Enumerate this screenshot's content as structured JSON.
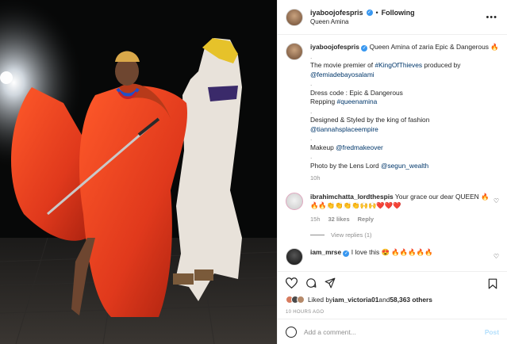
{
  "header": {
    "username": "iyaboojofespris",
    "separator": "•",
    "follow_status": "Following",
    "location": "Queen Amina",
    "more_icon": "more-horizontal-icon"
  },
  "caption": {
    "username": "iyaboojofespris",
    "title": "Queen Amina of zaria Epic & Dangerous 🔥",
    "line_premier_prefix": "The movie premier of ",
    "hashtag_movie": "#KingOfThieves",
    "line_premier_suffix": " produced by",
    "producer": "@femiadebayosalami",
    "dress_code": "Dress code : Epic & Dangerous",
    "repping_prefix": "Repping ",
    "hashtag_repping": "#queenamina",
    "designed_prefix": "Designed & Styled by the king of fashion ",
    "designer": "@tiannahsplaceempire",
    "makeup_prefix": "Makeup ",
    "makeup": "@fredmakeover",
    "photo_prefix": "Photo by the Lens Lord ",
    "photographer": "@segun_wealth",
    "spacer": ".",
    "time": "10h"
  },
  "comments": [
    {
      "username": "ibrahimchatta_lordthespis",
      "text": "Your grace our dear QUEEN 🔥",
      "text2": "🔥🔥👏👏👏👏🙌🙌❤️❤️❤️",
      "time": "15h",
      "likes": "32 likes",
      "reply": "Reply",
      "view_replies": "View replies (1)"
    },
    {
      "username": "iam_mrse",
      "text": "I love this 😍 🔥🔥🔥🔥🔥"
    }
  ],
  "likes": {
    "prefix": "Liked by ",
    "user": "iam_victoria01",
    "middle": " and ",
    "count": "58,363 others"
  },
  "post_time": "10 HOURS AGO",
  "add_comment": {
    "placeholder": "Add a comment...",
    "post_label": "Post"
  },
  "colors": {
    "link": "#00376b",
    "verified": "#3897f0",
    "muted": "#8e8e8e",
    "post_disabled": "#b2dffc",
    "dress_red": "#e0391c"
  }
}
